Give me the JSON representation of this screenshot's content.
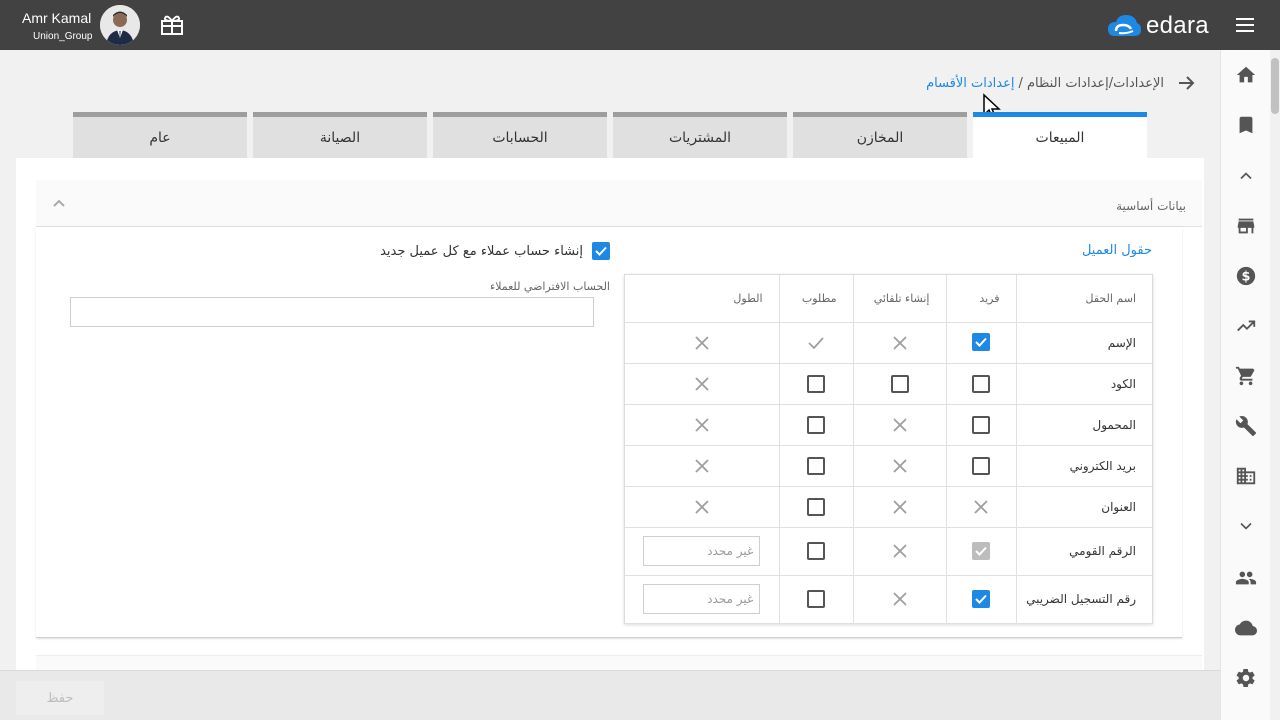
{
  "header": {
    "user_name": "Amr Kamal",
    "company": "Union_Group",
    "logo_text": "edara",
    "brand_color": "#1e88e5"
  },
  "breadcrumb": {
    "path": "الإعدادات/إعدادات النظام /",
    "current": "إعدادات الأقسام"
  },
  "tabs": [
    {
      "label": "المبيعات",
      "active": true
    },
    {
      "label": "المخازن",
      "active": false
    },
    {
      "label": "المشتريات",
      "active": false
    },
    {
      "label": "الحسابات",
      "active": false
    },
    {
      "label": "الصيانة",
      "active": false
    },
    {
      "label": "عام",
      "active": false
    }
  ],
  "section": {
    "title": "بيانات أساسية",
    "fields_title": "حقول العميل",
    "create_account_label": "إنشاء حساب عملاء مع كل عميل جديد",
    "create_account_checked": true,
    "default_account_label": "الحساب الافتراضي للعملاء",
    "default_account_value": ""
  },
  "table": {
    "headers": {
      "name": "اسم الحقل",
      "unique": "فريد",
      "auto": "إنشاء تلقائي",
      "required": "مطلوب",
      "length": "الطول"
    },
    "rows": [
      {
        "name": "الإسم",
        "unique": "checked",
        "auto": "x",
        "required": "check",
        "length": "x"
      },
      {
        "name": "الكود",
        "unique": "empty",
        "auto": "empty",
        "required": "empty",
        "length": "x"
      },
      {
        "name": "المحمول",
        "unique": "empty",
        "auto": "x",
        "required": "empty",
        "length": "x"
      },
      {
        "name": "بريد الكتروني",
        "unique": "empty",
        "auto": "x",
        "required": "empty",
        "length": "x"
      },
      {
        "name": "العنوان",
        "unique": "x",
        "auto": "x",
        "required": "empty",
        "length": "x"
      },
      {
        "name": "الرقم القومي",
        "unique": "disabled-checked",
        "auto": "x",
        "required": "empty",
        "length": "غير محدد"
      },
      {
        "name": "رقم التسجيل الضريبي",
        "unique": "checked",
        "auto": "x",
        "required": "empty",
        "length": "غير محدد"
      }
    ]
  },
  "footer": {
    "save_label": "حفظ"
  },
  "rail_icons": [
    "home-icon",
    "bookmark-icon",
    "chevron-up-icon",
    "store-icon",
    "dollar-icon",
    "trending-up-icon",
    "cart-icon",
    "wrench-icon",
    "building-icon",
    "chevron-down-icon",
    "people-icon",
    "cloud-icon",
    "settings-icon"
  ]
}
